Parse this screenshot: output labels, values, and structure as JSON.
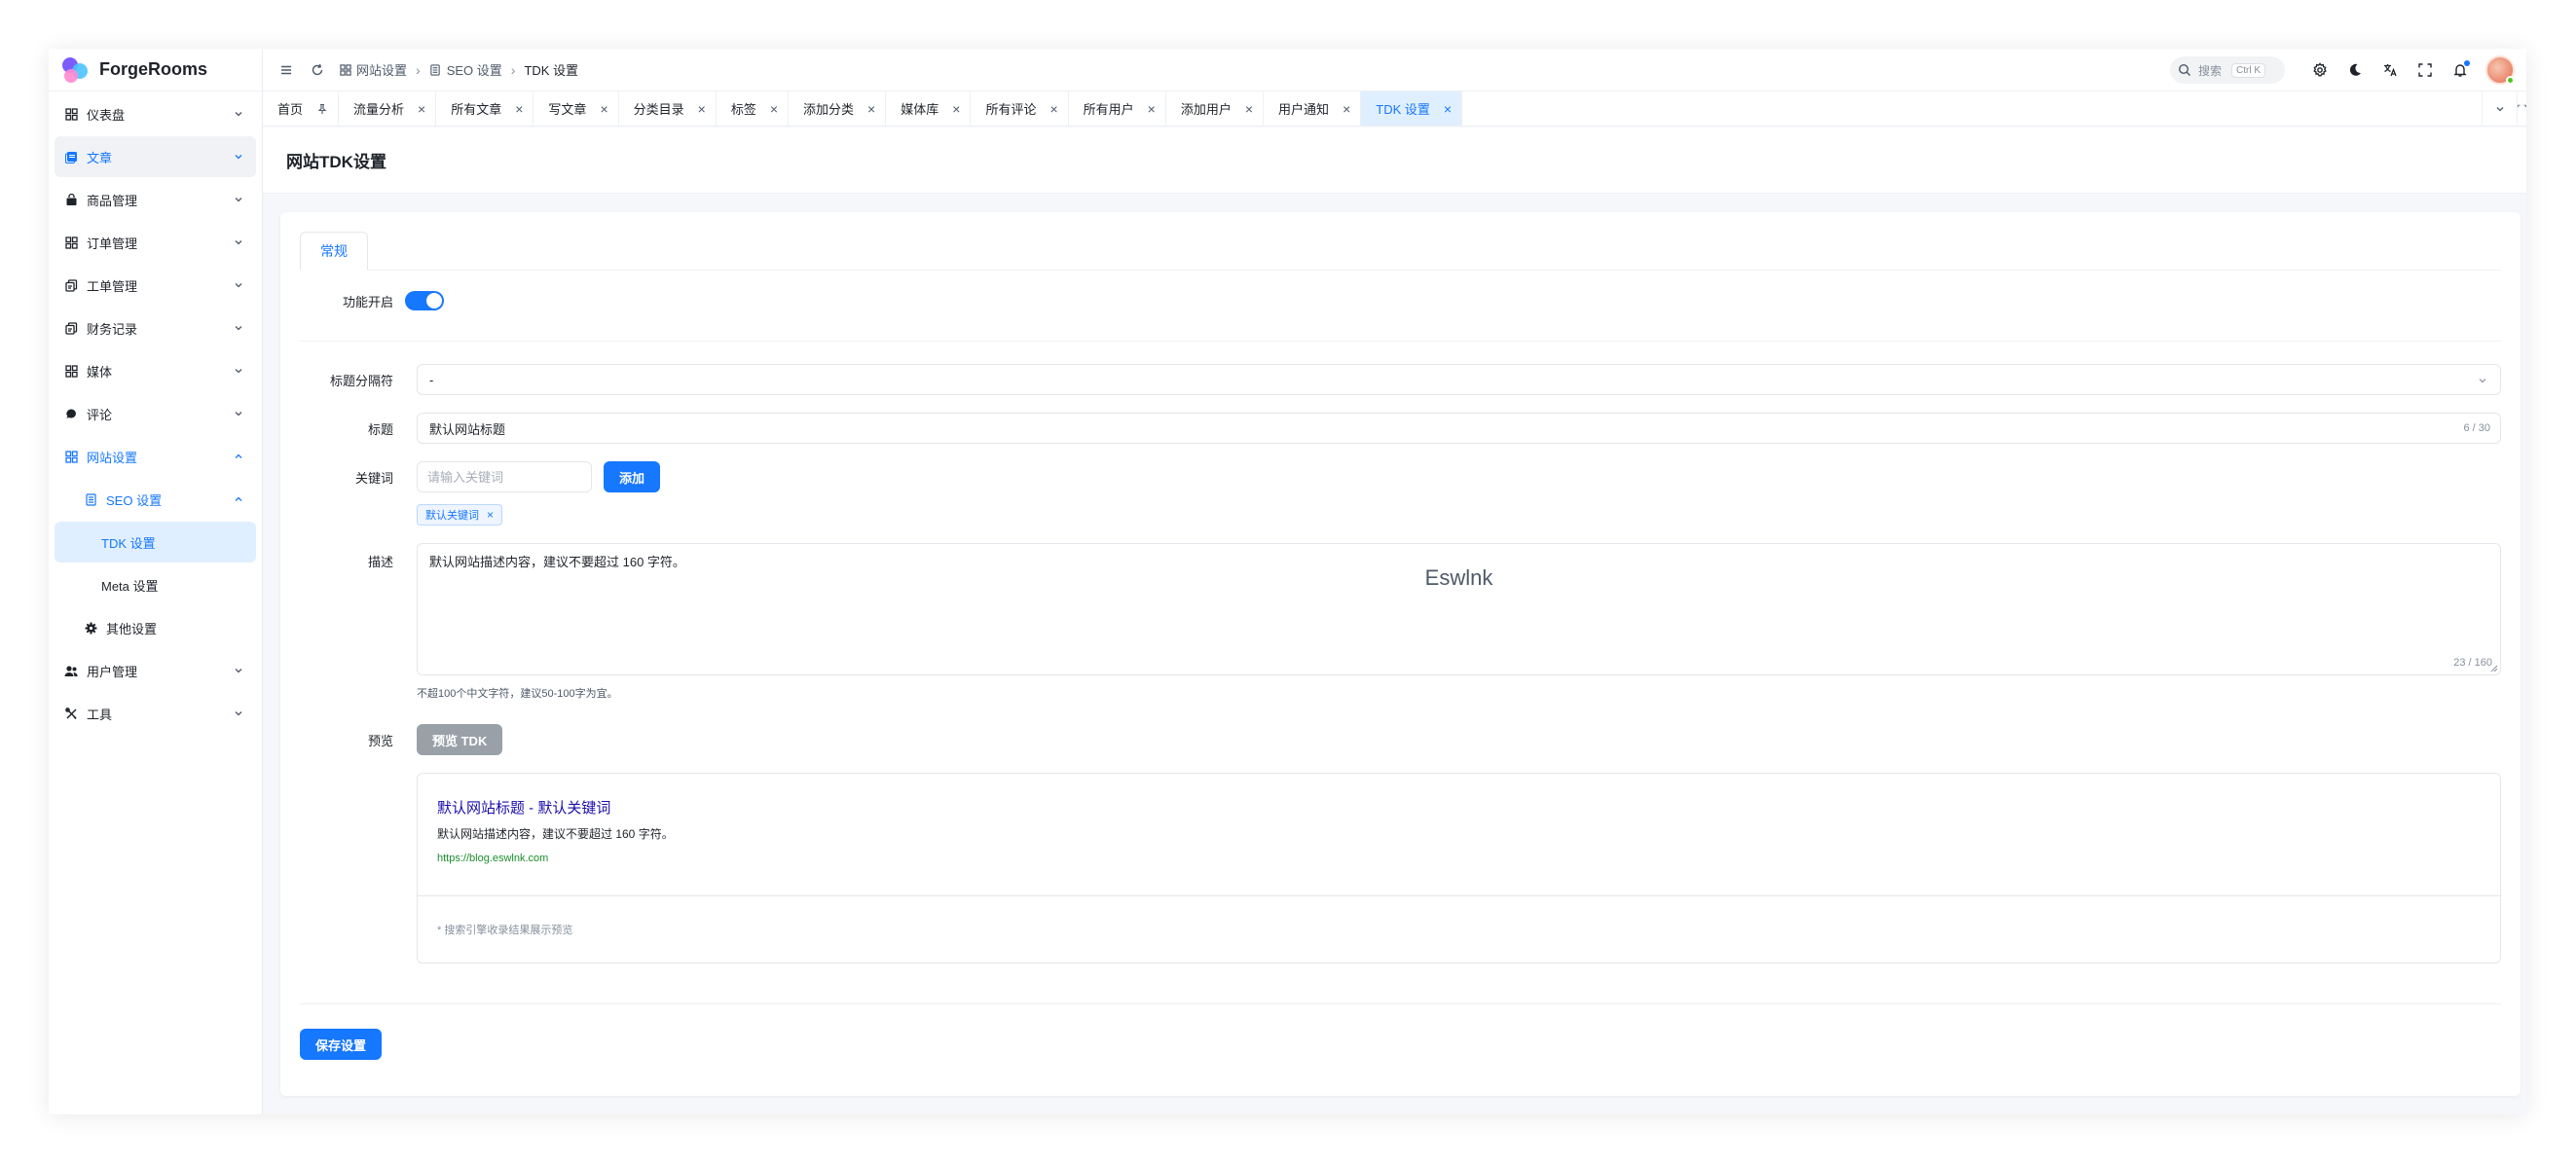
{
  "app": {
    "name": "ForgeRooms",
    "colors": {
      "accent": "#1677ff",
      "active_bg": "#e0efff",
      "link": "#1a0dab",
      "url": "#1a8f2b"
    }
  },
  "sidebar": {
    "items": [
      {
        "label": "仪表盘",
        "icon": "dashboard-grid-icon"
      },
      {
        "label": "文章",
        "icon": "article-icon"
      },
      {
        "label": "商品管理",
        "icon": "shopping-bag-icon"
      },
      {
        "label": "订单管理",
        "icon": "order-grid-icon"
      },
      {
        "label": "工单管理",
        "icon": "ticket-icon"
      },
      {
        "label": "财务记录",
        "icon": "finance-icon"
      },
      {
        "label": "媒体",
        "icon": "media-grid-icon"
      },
      {
        "label": "评论",
        "icon": "comment-icon"
      },
      {
        "label": "网站设置",
        "icon": "site-settings-grid-icon"
      },
      {
        "label": "SEO 设置",
        "icon": "seo-icon"
      },
      {
        "label": "TDK 设置"
      },
      {
        "label": "Meta 设置"
      },
      {
        "label": "其他设置",
        "icon": "gear-icon"
      },
      {
        "label": "用户管理",
        "icon": "users-icon"
      },
      {
        "label": "工具",
        "icon": "tools-icon"
      }
    ]
  },
  "topbar": {
    "breadcrumb": [
      "网站设置",
      "SEO 设置",
      "TDK 设置"
    ],
    "search_placeholder": "搜索",
    "search_shortcut": "Ctrl K"
  },
  "tabs": [
    {
      "label": "首页"
    },
    {
      "label": "流量分析"
    },
    {
      "label": "所有文章"
    },
    {
      "label": "写文章"
    },
    {
      "label": "分类目录"
    },
    {
      "label": "标签"
    },
    {
      "label": "添加分类"
    },
    {
      "label": "媒体库"
    },
    {
      "label": "所有评论"
    },
    {
      "label": "所有用户"
    },
    {
      "label": "添加用户"
    },
    {
      "label": "用户通知"
    },
    {
      "label": "TDK 设置"
    }
  ],
  "page": {
    "title": "网站TDK设置",
    "card_tab": "常规",
    "form": {
      "enable_label": "功能开启",
      "enabled": true,
      "separator_label": "标题分隔符",
      "separator_value": "-",
      "title_label": "标题",
      "title_value": "默认网站标题",
      "title_count": "6 / 30",
      "keywords_label": "关键词",
      "keywords_placeholder": "请输入关键词",
      "add_button": "添加",
      "keyword_tags": [
        "默认关键词"
      ],
      "description_label": "描述",
      "description_value": "默认网站描述内容，建议不要超过 160 字符。",
      "description_count": "23 / 160",
      "description_help": "不超100个中文字符，建议50-100字为宜。",
      "watermark": "Eswlnk",
      "preview_label": "预览",
      "preview_button": "预览 TDK",
      "save_button": "保存设置"
    },
    "preview": {
      "title": "默认网站标题 - 默认关键词",
      "description": "默认网站描述内容，建议不要超过 160 字符。",
      "url": "https://blog.eswlnk.com",
      "note": "* 搜索引擎收录结果展示预览"
    }
  }
}
